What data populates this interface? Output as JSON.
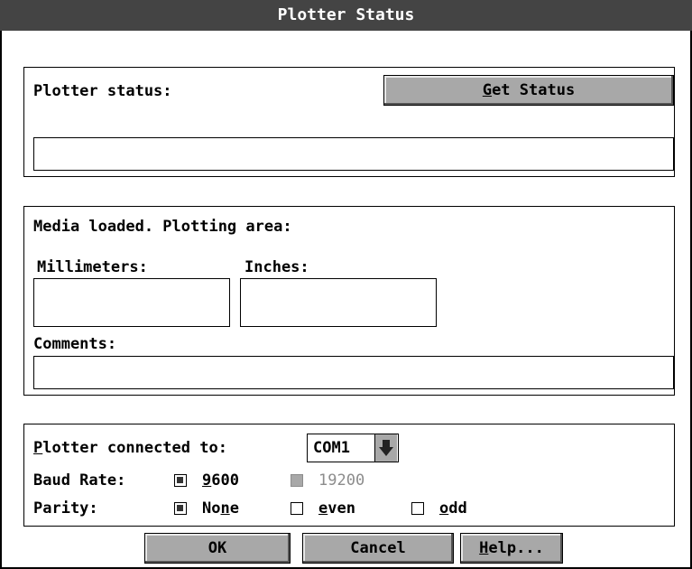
{
  "window": {
    "title": "Plotter Status"
  },
  "status_group": {
    "label": "Plotter status:",
    "get_status_button": {
      "prefix": "",
      "underline": "G",
      "suffix": "et Status"
    },
    "status_value": ""
  },
  "media_group": {
    "heading": "Media loaded. Plotting area:",
    "millimeters_label": "Millimeters:",
    "inches_label": "Inches:",
    "millimeters_value": "",
    "inches_value": "",
    "comments_label": "Comments:",
    "comments_value": ""
  },
  "connection_group": {
    "connected_label": {
      "underline": "P",
      "rest": "lotter connected to:"
    },
    "port_value": "COM1",
    "baud_label": "Baud Rate:",
    "baud_options": [
      {
        "label_underline": "9",
        "label_rest": "600",
        "checked": true,
        "enabled": true
      },
      {
        "label": "19200",
        "checked": false,
        "enabled": false
      }
    ],
    "parity_label": "Parity:",
    "parity_options": [
      {
        "pre": "No",
        "underline": "n",
        "post": "e",
        "checked": true
      },
      {
        "pre": "",
        "underline": "e",
        "post": "ven",
        "checked": false
      },
      {
        "pre": "",
        "underline": "o",
        "post": "dd",
        "checked": false
      }
    ]
  },
  "buttons": {
    "ok": "OK",
    "cancel": "Cancel",
    "help": {
      "underline": "H",
      "rest": "elp..."
    }
  }
}
